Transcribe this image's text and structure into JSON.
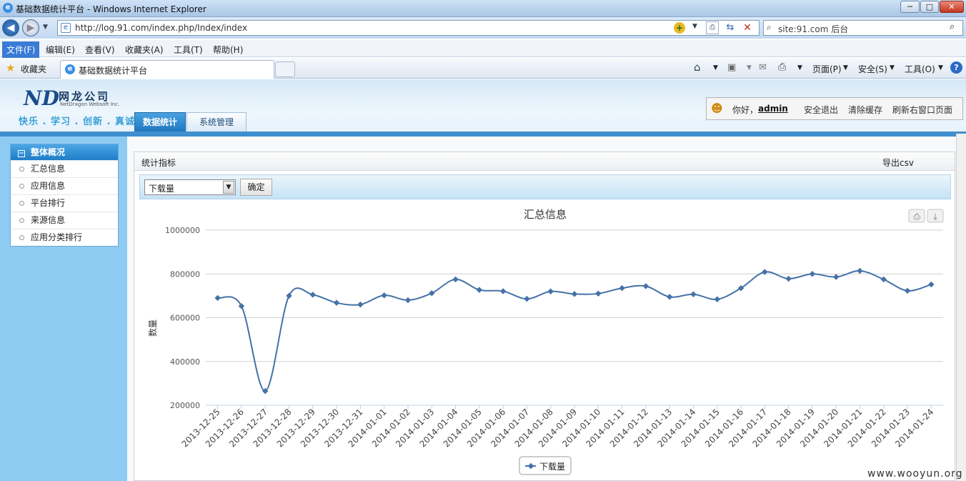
{
  "window": {
    "title": "基础数据统计平台 - Windows Internet Explorer",
    "min_label": "─",
    "max_label": "□",
    "close_label": "✕"
  },
  "address": {
    "url": "http://log.91.com/index.php/Index/index",
    "search_value": "site:91.com 后台"
  },
  "menu": {
    "items": [
      "文件(F)",
      "编辑(E)",
      "查看(V)",
      "收藏夹(A)",
      "工具(T)",
      "帮助(H)"
    ]
  },
  "favbar": {
    "favorites_label": "收藏夹",
    "tab_title": "基础数据统计平台",
    "page_label": "页面(P)",
    "safety_label": "安全(S)",
    "tools_label": "工具(O)"
  },
  "site": {
    "company_cn": "网龙公司",
    "company_en": "NetDragon Websoft Inc.",
    "slogan": "快乐 . 学习 . 创新 . 真诚",
    "tabs": [
      "数据统计",
      "系统管理"
    ],
    "greeting": "你好，",
    "username": "admin",
    "logout": "安全退出",
    "clear_cache": "清除缓存",
    "refresh": "刷新右窗口页面"
  },
  "sidebar": {
    "header": "整体概况",
    "items": [
      "汇总信息",
      "应用信息",
      "平台排行",
      "来源信息",
      "应用分类排行"
    ]
  },
  "content": {
    "heading": "统计指标",
    "export": "导出csv",
    "select_value": "下载量",
    "ok_label": "确定"
  },
  "watermark": "www.wooyun.org",
  "chart_data": {
    "type": "line",
    "title": "汇总信息",
    "ylabel": "数量",
    "ylim": [
      200000,
      1000000
    ],
    "yticks": [
      200000,
      400000,
      600000,
      800000,
      1000000
    ],
    "categories": [
      "2013-12-25",
      "2013-12-26",
      "2013-12-27",
      "2013-12-28",
      "2013-12-29",
      "2013-12-30",
      "2013-12-31",
      "2014-01-01",
      "2014-01-02",
      "2014-01-03",
      "2014-01-04",
      "2014-01-05",
      "2014-01-06",
      "2014-01-07",
      "2014-01-08",
      "2014-01-09",
      "2014-01-10",
      "2014-01-11",
      "2014-01-12",
      "2014-01-13",
      "2014-01-14",
      "2014-01-15",
      "2014-01-16",
      "2014-01-17",
      "2014-01-18",
      "2014-01-19",
      "2014-01-20",
      "2014-01-21",
      "2014-01-22",
      "2014-01-23",
      "2014-01-24"
    ],
    "series": [
      {
        "name": "下载量",
        "color": "#4572a7",
        "values": [
          690000,
          653000,
          265000,
          700000,
          705000,
          668000,
          660000,
          702000,
          680000,
          712000,
          775000,
          727000,
          721000,
          686000,
          720000,
          708000,
          710000,
          735000,
          744000,
          695000,
          707000,
          684000,
          735000,
          809000,
          778000,
          800000,
          786000,
          814000,
          775000,
          723000,
          752000
        ]
      }
    ],
    "grid": true,
    "legend": "bottom-center"
  }
}
